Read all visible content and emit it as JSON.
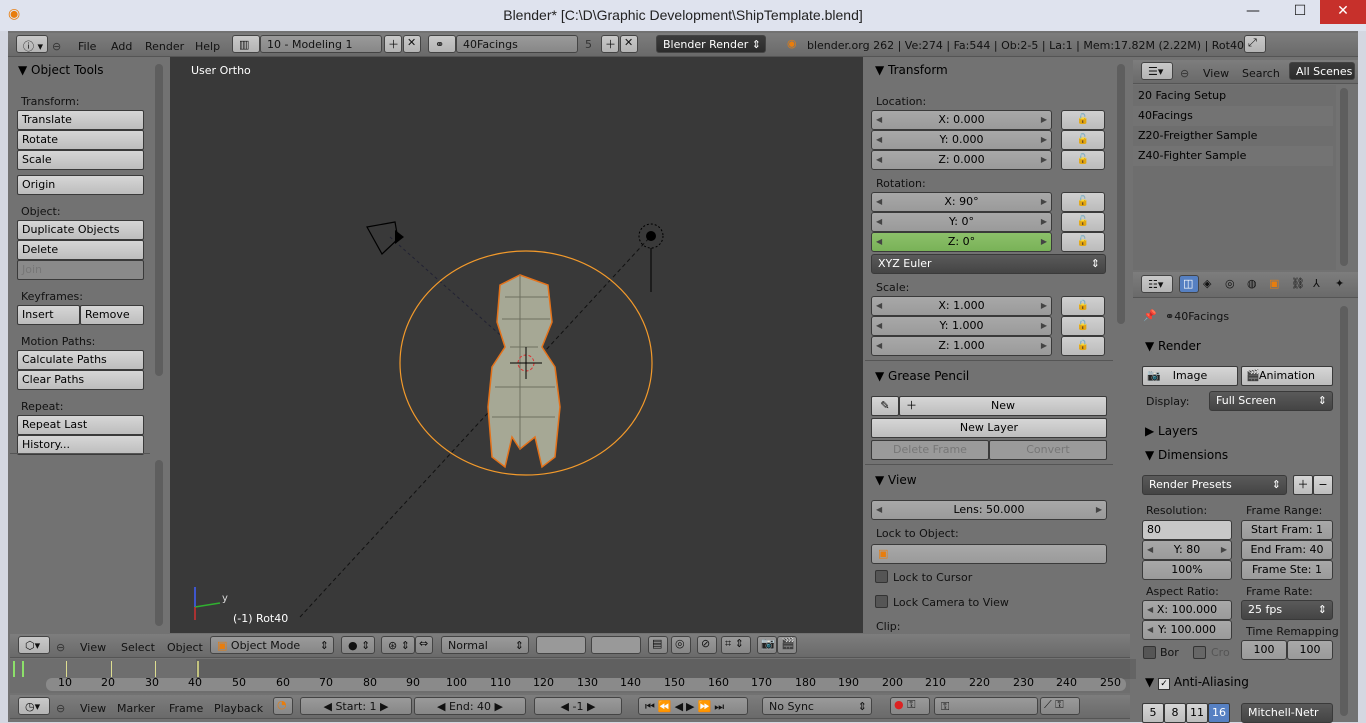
{
  "window": {
    "title": "Blender* [C:\\D\\Graphic Development\\ShipTemplate.blend]",
    "minimize": "—",
    "maximize": "☐",
    "close": "✕"
  },
  "info_header": {
    "menus": [
      "File",
      "Add",
      "Render",
      "Help"
    ],
    "screen_layout": "10 - Modeling 1",
    "scene": "40Facings",
    "scene_users": "5",
    "engine": "Blender Render",
    "stats": "blender.org 262 | Ve:274 | Fa:544 | Ob:2-5 | La:1 | Mem:17.82M (2.22M) | Rot40"
  },
  "tools": {
    "title": "Object Tools",
    "transform_label": "Transform:",
    "translate": "Translate",
    "rotate": "Rotate",
    "scale": "Scale",
    "origin": "Origin",
    "object_label": "Object:",
    "duplicate": "Duplicate Objects",
    "delete": "Delete",
    "join": "Join",
    "keyframes_label": "Keyframes:",
    "insert": "Insert",
    "remove": "Remove",
    "motion_label": "Motion Paths:",
    "calc_paths": "Calculate Paths",
    "clear_paths": "Clear Paths",
    "repeat_label": "Repeat:",
    "repeat_last": "Repeat Last",
    "history": "History..."
  },
  "viewport": {
    "label": "User Ortho",
    "object_label": "(-1) Rot40",
    "axis_y": "y",
    "axis_x": "x"
  },
  "properties": {
    "transform_title": "Transform",
    "location_label": "Location:",
    "loc_x": "X: 0.000",
    "loc_y": "Y: 0.000",
    "loc_z": "Z: 0.000",
    "rotation_label": "Rotation:",
    "rot_x": "X: 90°",
    "rot_y": "Y: 0°",
    "rot_z": "Z: 0°",
    "rotation_mode": "XYZ Euler",
    "scale_label": "Scale:",
    "scale_x": "X: 1.000",
    "scale_y": "Y: 1.000",
    "scale_z": "Z: 1.000",
    "grease_title": "Grease Pencil",
    "gp_new": "New",
    "gp_new_layer": "New Layer",
    "gp_delete_frame": "Delete Frame",
    "gp_convert": "Convert",
    "view_title": "View",
    "lens": "Lens: 50.000",
    "lock_object_label": "Lock to Object:",
    "lock_cursor": "Lock to Cursor",
    "lock_camera": "Lock Camera to View",
    "clip_label": "Clip:"
  },
  "outliner": {
    "menus": [
      "View",
      "Search"
    ],
    "filter": "All Scenes",
    "items": [
      "20 Facing Setup",
      "40Facings",
      "Z20-Freigther Sample",
      "Z40-Fighter Sample"
    ]
  },
  "render_props": {
    "scene_name": "40Facings",
    "render_title": "Render",
    "image_btn": "Image",
    "animation_btn": "Animation",
    "display_label": "Display:",
    "display_value": "Full Screen",
    "layers_title": "Layers",
    "dimensions_title": "Dimensions",
    "render_presets": "Render Presets",
    "resolution_label": "Resolution:",
    "res_x": "80",
    "res_y": "Y: 80",
    "res_pct": "100%",
    "frame_range_label": "Frame Range:",
    "start_frame": "Start Fram: 1",
    "end_frame": "End Fram: 40",
    "frame_step": "Frame Ste: 1",
    "aspect_label": "Aspect Ratio:",
    "aspect_x": "X: 100.000",
    "aspect_y": "Y: 100.000",
    "frame_rate_label": "Frame Rate:",
    "frame_rate": "25 fps",
    "time_remap_label": "Time Remapping:",
    "remap_old": "100",
    "remap_new": "100",
    "border": "Bor",
    "crop": "Cro",
    "aa_title": "Anti-Aliasing",
    "aa_samples": [
      "5",
      "8",
      "11",
      "16"
    ],
    "aa_filter": "Mitchell-Netr"
  },
  "view3d_header": {
    "menus": [
      "View",
      "Select",
      "Object"
    ],
    "mode": "Object Mode",
    "orientation": "Normal"
  },
  "timeline": {
    "ticks": [
      "10",
      "20",
      "30",
      "40",
      "50",
      "60",
      "70",
      "80",
      "90",
      "100",
      "110",
      "120",
      "130",
      "140",
      "150",
      "160",
      "170",
      "180",
      "190",
      "200",
      "210",
      "220",
      "230",
      "240",
      "250"
    ],
    "menus": [
      "View",
      "Marker",
      "Frame",
      "Playback"
    ],
    "start": "Start: 1",
    "end": "End: 40",
    "current": "-1",
    "sync": "No Sync"
  }
}
